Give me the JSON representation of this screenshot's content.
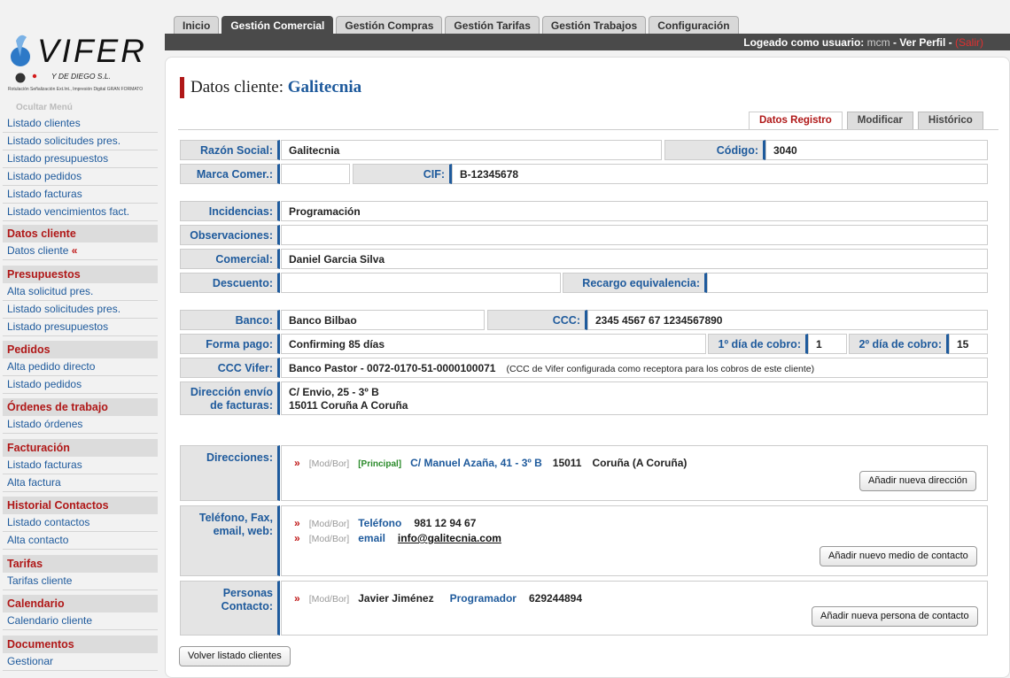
{
  "top_tabs": [
    "Inicio",
    "Gestión Comercial",
    "Gestión Compras",
    "Gestión Tarifas",
    "Gestión Trabajos",
    "Configuración"
  ],
  "active_top_tab": "Gestión Comercial",
  "userbar": {
    "prefix": "Logeado como usuario:",
    "username": "mcm",
    "sep1": " - ",
    "profile": "Ver Perfil",
    "sep2": " - ",
    "logout": "(Salir)"
  },
  "logo": {
    "brand": "VIFER",
    "tagline": "Y DE DIEGO S.L.",
    "subtitle": "Rotulación Señalización Ext.Int., Impresión Digital GRAN FORMATO"
  },
  "sidebar": {
    "hide_menu": "Ocultar Menú",
    "general": [
      "Listado clientes",
      "Listado solicitudes pres.",
      "Listado presupuestos",
      "Listado pedidos",
      "Listado facturas",
      "Listado vencimientos fact."
    ],
    "sections": [
      {
        "title": "Datos cliente",
        "items": [
          "Datos cliente"
        ],
        "selected": "«"
      },
      {
        "title": "Presupuestos",
        "items": [
          "Alta solicitud pres.",
          "Listado solicitudes pres.",
          "Listado presupuestos"
        ]
      },
      {
        "title": "Pedidos",
        "items": [
          "Alta pedido directo",
          "Listado pedidos"
        ]
      },
      {
        "title": "Órdenes de trabajo",
        "items": [
          "Listado órdenes"
        ]
      },
      {
        "title": "Facturación",
        "items": [
          "Listado facturas",
          "Alta factura"
        ]
      },
      {
        "title": "Historial Contactos",
        "items": [
          "Listado contactos",
          "Alta contacto"
        ]
      },
      {
        "title": "Tarifas",
        "items": [
          "Tarifas cliente"
        ]
      },
      {
        "title": "Calendario",
        "items": [
          "Calendario cliente"
        ]
      },
      {
        "title": "Documentos",
        "items": [
          "Gestionar"
        ]
      }
    ]
  },
  "page": {
    "title_prefix": "Datos cliente:",
    "client_name": "Galitecnia"
  },
  "sub_tabs": [
    "Datos Registro",
    "Modificar",
    "Histórico"
  ],
  "active_sub_tab": "Datos Registro",
  "form": {
    "razon_social": {
      "label": "Razón Social:",
      "value": "Galitecnia"
    },
    "codigo": {
      "label": "Código:",
      "value": "3040"
    },
    "marca": {
      "label": "Marca Comer.:",
      "value": ""
    },
    "cif": {
      "label": "CIF:",
      "value": "B-12345678"
    },
    "incidencias": {
      "label": "Incidencias:",
      "value": "Programación"
    },
    "observaciones": {
      "label": "Observaciones:",
      "value": ""
    },
    "comercial": {
      "label": "Comercial:",
      "value": "Daniel Garcia Silva"
    },
    "descuento": {
      "label": "Descuento:",
      "value": ""
    },
    "recargo": {
      "label": "Recargo equivalencia:",
      "value": ""
    },
    "banco": {
      "label": "Banco:",
      "value": "Banco Bilbao"
    },
    "ccc": {
      "label": "CCC:",
      "value": "2345 4567 67 1234567890"
    },
    "forma_pago": {
      "label": "Forma pago:",
      "value": "Confirming 85 días"
    },
    "dia1": {
      "label": "1º día de cobro:",
      "value": "1"
    },
    "dia2": {
      "label": "2º día de cobro:",
      "value": "15"
    },
    "ccc_vifer": {
      "label": "CCC Vifer:",
      "value": "Banco Pastor - 0072-0170-51-0000100071",
      "note": "(CCC de Vifer configurada como receptora para los cobros de este cliente)"
    },
    "direccion_envio": {
      "label_line1": "Dirección envío",
      "label_line2": "de facturas:",
      "line1": "C/ Envio, 25 - 3º B",
      "line2": "15011 Coruña A Coruña"
    }
  },
  "direcciones": {
    "label": "Direcciones:",
    "entries": [
      {
        "bullet": "»",
        "modbor": "[Mod/Bor]",
        "tag": "[Principal]",
        "street": "C/ Manuel Azaña, 41 - 3º B",
        "postal": "15011",
        "city": "Coruña (A Coruña)"
      }
    ],
    "button": "Añadir nueva dirección"
  },
  "contacto": {
    "label_line1": "Teléfono, Fax,",
    "label_line2": "email, web:",
    "entries": [
      {
        "bullet": "»",
        "modbor": "[Mod/Bor]",
        "type": "Teléfono",
        "value": "981 12 94 67"
      },
      {
        "bullet": "»",
        "modbor": "[Mod/Bor]",
        "type": "email",
        "value": "info@galitecnia.com"
      }
    ],
    "button": "Añadir nuevo medio de contacto"
  },
  "personas": {
    "label_line1": "Personas",
    "label_line2": "Contacto:",
    "entries": [
      {
        "bullet": "»",
        "modbor": "[Mod/Bor]",
        "name": "Javier Jiménez",
        "role": "Programador",
        "phone": "629244894"
      }
    ],
    "button": "Añadir nueva persona de contacto"
  },
  "back_button": "Volver listado clientes",
  "colors": {
    "accent_red": "#b01818",
    "accent_blue": "#1e5a9c",
    "dark_bar": "#4a4a4a"
  }
}
